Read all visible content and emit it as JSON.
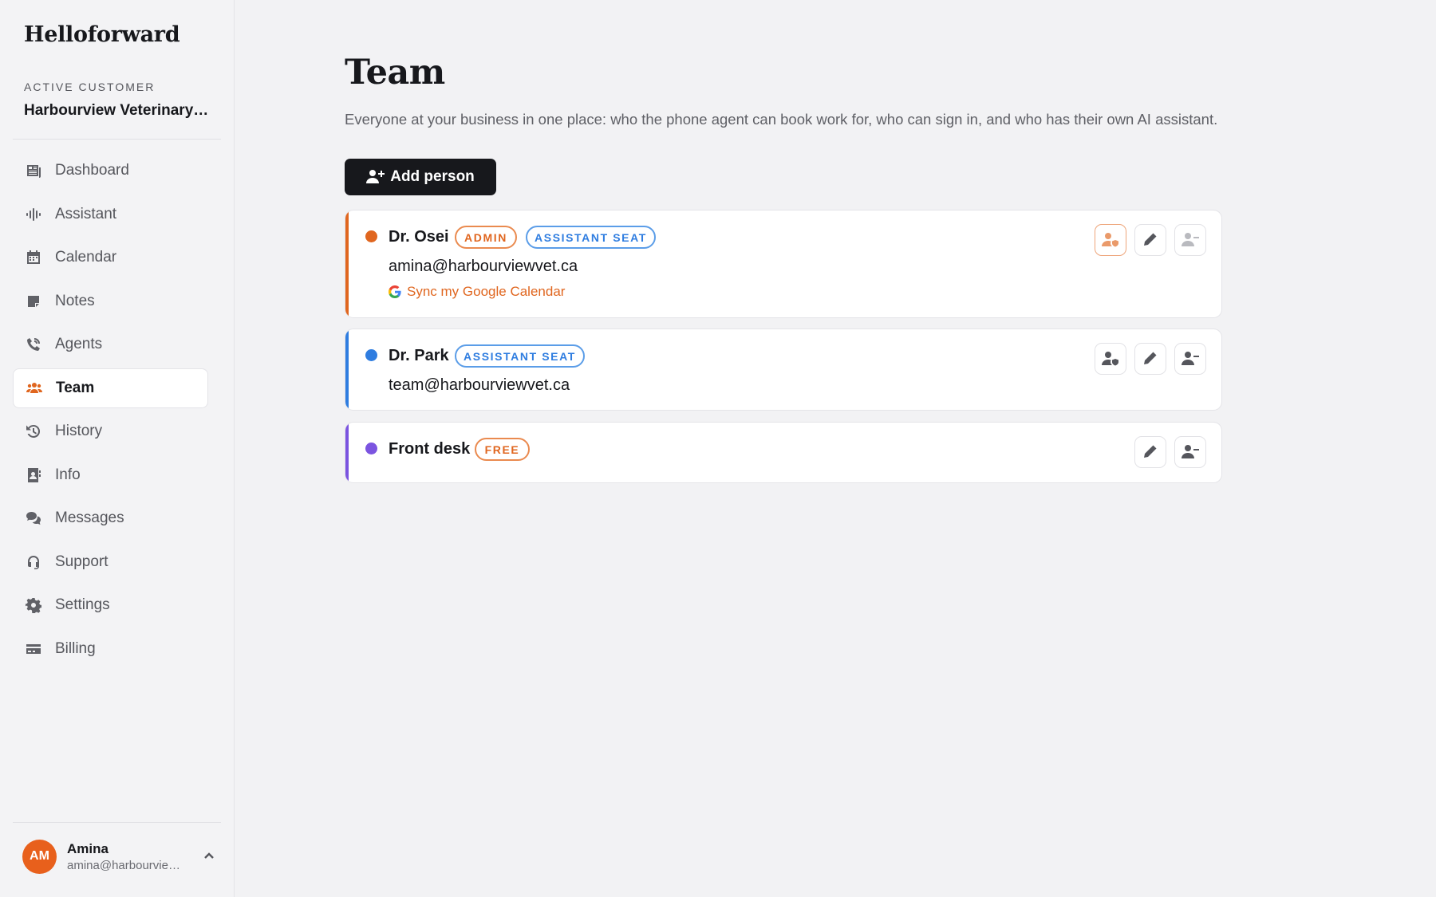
{
  "sidebar": {
    "brand": "Helloforward",
    "customer_label": "ACTIVE CUSTOMER",
    "customer_name": "Harbourview Veterinary Hospital",
    "items": [
      {
        "label": "Dashboard",
        "icon": "dashboard-icon"
      },
      {
        "label": "Assistant",
        "icon": "waveform-icon"
      },
      {
        "label": "Calendar",
        "icon": "calendar-icon"
      },
      {
        "label": "Notes",
        "icon": "note-icon"
      },
      {
        "label": "Agents",
        "icon": "phone-icon"
      },
      {
        "label": "Team",
        "icon": "users-icon",
        "active": true
      },
      {
        "label": "History",
        "icon": "history-icon"
      },
      {
        "label": "Info",
        "icon": "contact-card-icon"
      },
      {
        "label": "Messages",
        "icon": "chat-icon"
      },
      {
        "label": "Support",
        "icon": "headset-icon"
      },
      {
        "label": "Settings",
        "icon": "gear-icon"
      },
      {
        "label": "Billing",
        "icon": "credit-card-icon"
      }
    ],
    "user": {
      "initials": "AM",
      "name": "Amina",
      "email": "amina@harbourviewvet.ca"
    }
  },
  "main": {
    "title": "Team",
    "description": "Everyone at your business in one place: who the phone agent can book work for, who can sign in, and who has their own AI assistant.",
    "add_button": "Add person",
    "people": [
      {
        "name": "Dr. Osei",
        "color": "#e0661f",
        "badges": [
          "ADMIN",
          "ASSISTANT SEAT"
        ],
        "email": "amina@harbourviewvet.ca",
        "sync_link": "Sync my Google Calendar"
      },
      {
        "name": "Dr. Park",
        "color": "#2f7de0",
        "badges": [
          "ASSISTANT SEAT"
        ],
        "email": "team@harbourviewvet.ca"
      },
      {
        "name": "Front desk",
        "color": "#7b54e0",
        "badges": [
          "FREE"
        ]
      }
    ]
  },
  "colors": {
    "accent": "#e0661f",
    "blue": "#2f7de0",
    "purple": "#7b54e0",
    "dark_button": "#17181c"
  }
}
